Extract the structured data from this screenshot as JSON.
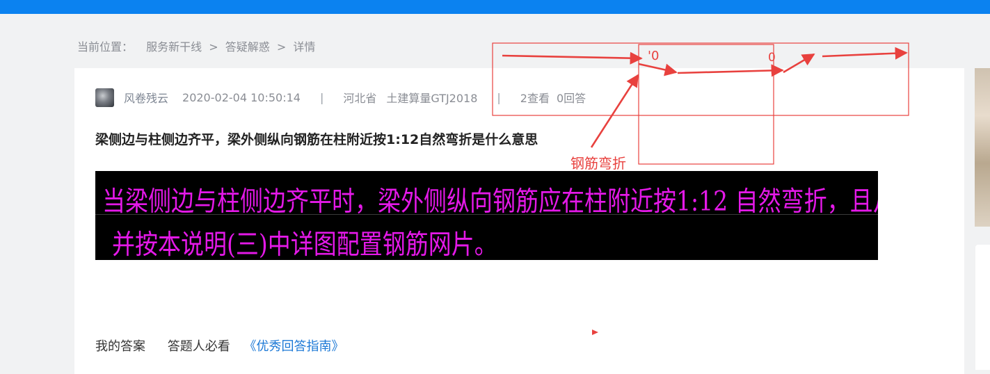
{
  "breadcrumb": {
    "lead": "当前位置：",
    "items": [
      "服务新干线",
      "答疑解惑",
      "详情"
    ],
    "separator": ">"
  },
  "question": {
    "author": "风卷残云",
    "datetime": "2020-02-04 10:50:14",
    "divider": "|",
    "region": "河北省",
    "tag": "土建算量GTJ2018",
    "views": "2查看",
    "answers": "0回答",
    "title": "梁侧边与柱侧边齐平，梁外侧纵向钢筋在柱附近按1:12自然弯折是什么意思"
  },
  "question_image": {
    "line1": "当梁侧边与柱侧边齐平时，梁外侧纵向钢筋应在柱附近按1:12 自然弯折，且从柱纵筋内侧通过或锚固，",
    "line2": "并按本说明(三)中详图配置钢筋网片。",
    "text_color": "#e419e8"
  },
  "annotation": {
    "label": "钢筋弯折",
    "marks": [
      "'0",
      "0"
    ],
    "color": "#e8413e"
  },
  "answer_bar": {
    "my_answer": "我的答案",
    "must_read": "答题人必看",
    "guide_link": "《优秀回答指南》"
  },
  "colors": {
    "topbar": "#0b82f0",
    "page_bg": "#f1f2f3",
    "link": "#1b78d6"
  }
}
